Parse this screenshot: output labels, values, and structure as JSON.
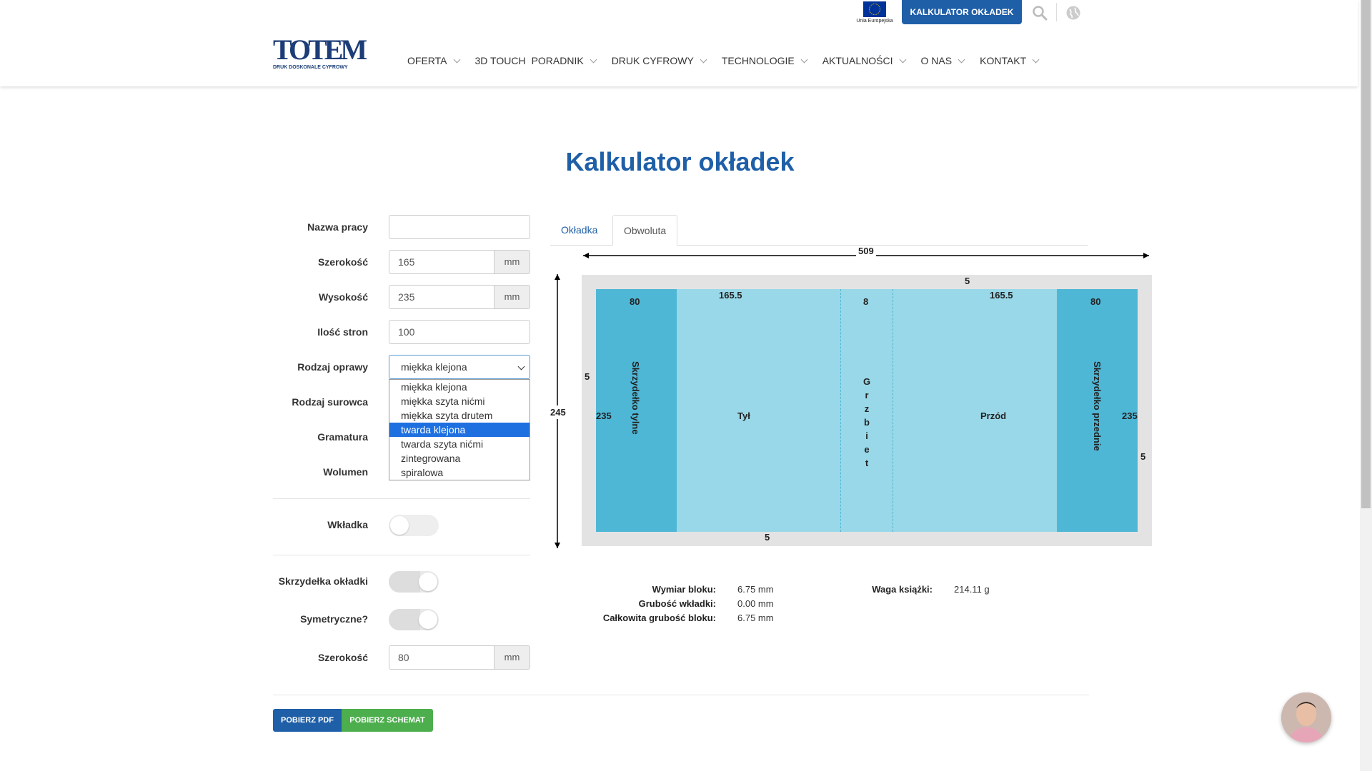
{
  "header": {
    "eu_logo_text": "Unia Europejska",
    "cta_button": "KALKULATOR OKŁADEK",
    "logo_text": "TOTEM",
    "logo_tagline": "DRUK DOSKONALE CYFROWY",
    "nav": [
      {
        "label": "OFERTA",
        "has_dropdown": true
      },
      {
        "label": "3D TOUCH",
        "has_dropdown": false
      },
      {
        "label": "PORADNIK",
        "has_dropdown": true
      },
      {
        "label": "DRUK CYFROWY",
        "has_dropdown": true
      },
      {
        "label": "TECHNOLOGIE",
        "has_dropdown": true
      },
      {
        "label": "AKTUALNOŚCI",
        "has_dropdown": true
      },
      {
        "label": "O NAS",
        "has_dropdown": true
      },
      {
        "label": "KONTAKT",
        "has_dropdown": true
      }
    ]
  },
  "page_title": "Kalkulator okładek",
  "form": {
    "job_name": {
      "label": "Nazwa pracy",
      "value": ""
    },
    "width": {
      "label": "Szerokość",
      "value": "165",
      "unit": "mm"
    },
    "height": {
      "label": "Wysokość",
      "value": "235",
      "unit": "mm"
    },
    "pages": {
      "label": "Ilość stron",
      "value": "100"
    },
    "binding": {
      "label": "Rodzaj oprawy",
      "value": "miękka klejona",
      "options": [
        "miękka klejona",
        "miękka szyta nićmi",
        "miękka szyta drutem",
        "twarda klejona",
        "twarda szyta nićmi",
        "zintegrowana",
        "spiralowa"
      ],
      "highlighted": "twarda klejona"
    },
    "material": {
      "label": "Rodzaj surowca"
    },
    "grammage": {
      "label": "Gramatura"
    },
    "volume": {
      "label": "Wolumen"
    },
    "insert": {
      "label": "Wkładka",
      "on": false
    },
    "flaps": {
      "label": "Skrzydełka okładki",
      "on": true
    },
    "symmetric": {
      "label": "Symetryczne?",
      "on": true
    },
    "flap_width": {
      "label": "Szerokość",
      "value": "80",
      "unit": "mm"
    }
  },
  "tabs": [
    "Okładka",
    "Obwoluta"
  ],
  "active_tab": "Obwoluta",
  "diagram": {
    "total_width": "509",
    "total_height": "245",
    "bleed_top": "5",
    "bleed_left": "5",
    "bleed_right": "5",
    "bleed_bottom": "5",
    "back_flap_width": "80",
    "back_width": "165.5",
    "spine_width": "8",
    "front_width": "165.5",
    "front_flap_width": "80",
    "inner_height_left": "235",
    "inner_height_right": "235",
    "back_flap_label": "Skrzydełko tylne",
    "back_label": "Tył",
    "spine_label": "Grzbiet",
    "front_label": "Przód",
    "front_flap_label": "Skrzydełko przednie",
    "colors": {
      "flap": "#4fb7d6",
      "face": "#99d8e8",
      "bleed": "#e3e3e3"
    }
  },
  "results": {
    "block_dim_label": "Wymiar bloku:",
    "block_dim_value": "6.75 mm",
    "insert_thickness_label": "Grubość wkładki:",
    "insert_thickness_value": "0.00 mm",
    "total_thickness_label": "Całkowita grubość bloku:",
    "total_thickness_value": "6.75 mm",
    "weight_label": "Waga książki:",
    "weight_value": "214.11 g"
  },
  "buttons": {
    "pdf": "POBIERZ PDF",
    "schema": "POBIERZ SCHEMAT"
  },
  "colors": {
    "primary": "#1f5fa8",
    "success": "#4cae4c"
  }
}
